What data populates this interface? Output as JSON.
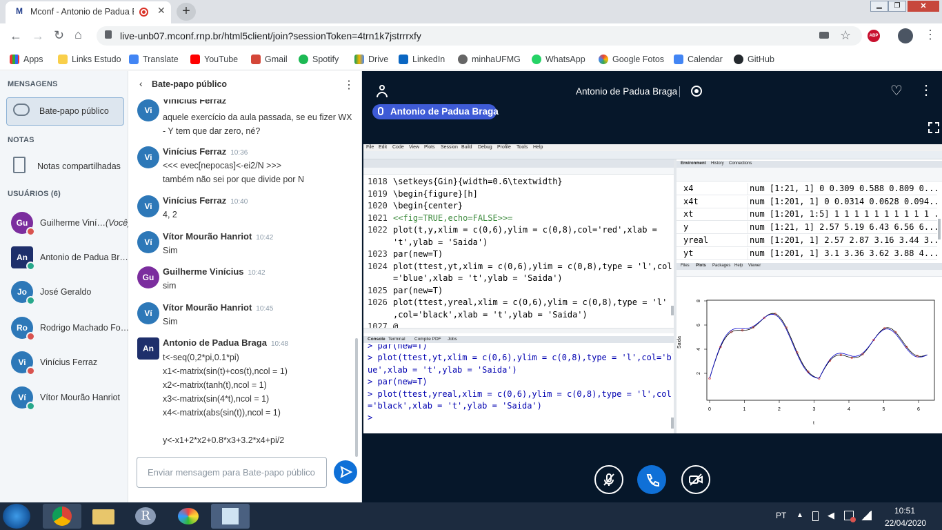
{
  "browser": {
    "tab_title": "Mconf - Antonio de Padua B",
    "url": "live-unb07.mconf.rnp.br/html5client/join?sessionToken=4trn1k7jstrrrxfy",
    "bookmarks": [
      "Apps",
      "Links Estudo",
      "Translate",
      "YouTube",
      "Gmail",
      "Spotify",
      "Drive",
      "LinkedIn",
      "minhaUFMG",
      "WhatsApp",
      "Google Fotos",
      "Calendar",
      "GitHub"
    ],
    "abp_label": "ABP"
  },
  "leftnav": {
    "messages_header": "MENSAGENS",
    "public_chat": "Bate-papo público",
    "notes_header": "NOTAS",
    "shared_notes": "Notas compartilhadas",
    "users_header": "USUÁRIOS (6)",
    "users": [
      {
        "initials": "Gu",
        "name": "Guilherme Viní…",
        "suffix": "(Você)",
        "color": "#7b2d9e"
      },
      {
        "initials": "An",
        "name": "Antonio de Padua Br…",
        "suffix": "",
        "color": "#1e2f6b"
      },
      {
        "initials": "Jo",
        "name": "José Geraldo",
        "suffix": "",
        "color": "#2d78b8"
      },
      {
        "initials": "Ro",
        "name": "Rodrigo Machado Fo…",
        "suffix": "",
        "color": "#2d78b8"
      },
      {
        "initials": "Vi",
        "name": "Vinícius Ferraz",
        "suffix": "",
        "color": "#2d78b8"
      },
      {
        "initials": "Ví",
        "name": "Vítor Mourão Hanriot",
        "suffix": "",
        "color": "#2d78b8"
      }
    ]
  },
  "chat": {
    "title": "Bate-papo público",
    "input_placeholder": "Enviar mensagem para Bate-papo público",
    "messages": [
      {
        "initials": "Vi",
        "name": "Vinícius Ferraz",
        "time": "",
        "lines": [
          "aquele exercício da aula passada, se eu fizer WX",
          "- Y tem que dar zero, né?"
        ]
      },
      {
        "initials": "Vi",
        "name": "Vinícius Ferraz",
        "time": "10:36",
        "lines": [
          "<<< evec[nepocas]<-ei2/N >>>",
          "também não sei por que divide por N"
        ]
      },
      {
        "initials": "Vi",
        "name": "Vinícius Ferraz",
        "time": "10:40",
        "lines": [
          "4, 2"
        ]
      },
      {
        "initials": "Ví",
        "name": "Vítor Mourão Hanriot",
        "time": "10:42",
        "lines": [
          "Sim"
        ]
      },
      {
        "initials": "Gu",
        "name": "Guilherme Vinícius",
        "time": "10:42",
        "lines": [
          "sim"
        ]
      },
      {
        "initials": "Ví",
        "name": "Vítor Mourão Hanriot",
        "time": "10:45",
        "lines": [
          "Sim"
        ]
      },
      {
        "initials": "An",
        "name": "Antonio de Padua Braga",
        "time": "10:48",
        "lines": [
          "t<-seq(0,2*pi,0.1*pi)",
          "x1<-matrix(sin(t)+cos(t),ncol = 1)",
          "x2<-matrix(tanh(t),ncol = 1)",
          "x3<-matrix(sin(4*t),ncol = 1)",
          "x4<-matrix(abs(sin(t)),ncol = 1)",
          "",
          "y<-x1+2*x2+0.8*x3+3.2*x4+pi/2"
        ]
      }
    ]
  },
  "presentation": {
    "presenter_title": "Antonio de Padua Braga",
    "presenter_badge": "Antonio de Padua Braga"
  },
  "rstudio": {
    "menu": [
      "File",
      "Edit",
      "Code",
      "View",
      "Plots",
      "Session",
      "Build",
      "Debug",
      "Profile",
      "Tools",
      "Help"
    ],
    "editor_lines": [
      {
        "n": "1018",
        "code": "\\setkeys{Gin}{width=0.6\\textwidth}"
      },
      {
        "n": "1019",
        "code": "\\begin{figure}[h]"
      },
      {
        "n": "1020",
        "code": "\\begin{center}"
      },
      {
        "n": "1021",
        "code": "<<fig=TRUE,echo=FALSE>>="
      },
      {
        "n": "1022",
        "code": "plot(t,y,xlim = c(0,6),ylim = c(0,8),col='red',xlab ="
      },
      {
        "n": "",
        "code": "'t',ylab = 'Saida')"
      },
      {
        "n": "1023",
        "code": "par(new=T)"
      },
      {
        "n": "1024",
        "code": "plot(ttest,yt,xlim = c(0,6),ylim = c(0,8),type = 'l',col"
      },
      {
        "n": "",
        "code": "='blue',xlab = 't',ylab = 'Saida')"
      },
      {
        "n": "1025",
        "code": "par(new=T)"
      },
      {
        "n": "1026",
        "code": "plot(ttest,yreal,xlim = c(0,6),ylim = c(0,8),type = 'l'"
      },
      {
        "n": "",
        "code": ",col='black',xlab = 't',ylab = 'Saida')"
      },
      {
        "n": "1027",
        "code": "@"
      }
    ],
    "console_tabs": [
      "Console",
      "Terminal",
      "Compile PDF",
      "Jobs"
    ],
    "console_lines": [
      "> par(new=T)",
      "> plot(ttest,yt,xlim = c(0,6),ylim = c(0,8),type = 'l',col='bl",
      "ue',xlab = 't',ylab = 'Saida')",
      "> par(new=T)",
      "> plot(ttest,yreal,xlim = c(0,6),ylim = c(0,8),type = 'l',col",
      "='black',xlab = 't',ylab = 'Saida')",
      ">"
    ],
    "env_tabs": [
      "Environment",
      "History",
      "Connections"
    ],
    "env_rows": [
      {
        "name": "x4",
        "value": "num [1:21, 1] 0 0.309 0.588 0.809 0..."
      },
      {
        "name": "x4t",
        "value": "num [1:201, 1] 0 0.0314 0.0628 0.094..."
      },
      {
        "name": "xt",
        "value": "num [1:201, 1:5] 1 1 1 1 1 1 1 1 1 1 ..."
      },
      {
        "name": "y",
        "value": "num [1:21, 1] 2.57 5.19 6.43 6.56 6..."
      },
      {
        "name": "yreal",
        "value": "num [1:201, 1] 2.57 2.87 3.16 3.44 3..."
      },
      {
        "name": "yt",
        "value": "num [1:201, 1] 3.1 3.36 3.62 3.88 4..."
      }
    ],
    "plot_tabs": [
      "Files",
      "Plots",
      "Packages",
      "Help",
      "Viewer"
    ],
    "plot": {
      "ylabel": "Saida",
      "xlabel": "t",
      "xticks": [
        "0",
        "1",
        "2",
        "3",
        "4",
        "5",
        "6"
      ],
      "yticks": [
        "2",
        "4",
        "6",
        "8"
      ]
    }
  },
  "taskbar": {
    "lang": "PT",
    "time": "10:51",
    "date": "22/04/2020"
  }
}
